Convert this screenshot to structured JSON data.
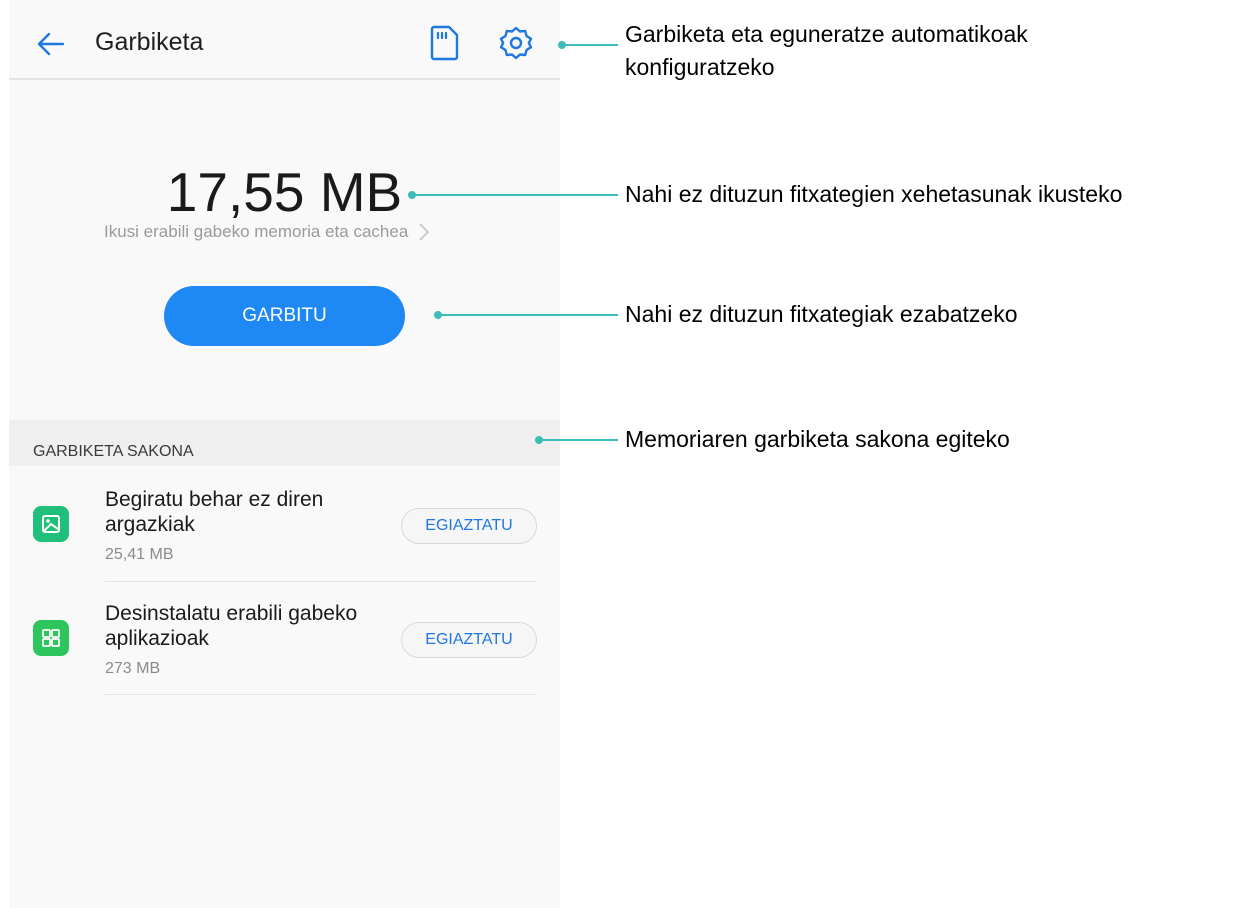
{
  "header": {
    "title": "Garbiketa",
    "back_icon": "arrow-left-icon",
    "sd_icon": "sd-card-icon",
    "settings_icon": "gear-icon"
  },
  "storage": {
    "size": "17,55 MB",
    "details_link": "Ikusi erabili gabeko memoria eta cachea"
  },
  "clean_button": {
    "label": "GARBITU",
    "color": "#1e88f5"
  },
  "deep_clean": {
    "header": "GARBIKETA SAKONA",
    "items": [
      {
        "title": "Begiratu behar ez diren argazkiak",
        "size": "25,41 MB",
        "button": "EGIAZTATU",
        "icon": "image-icon",
        "icon_color": "#21c07a"
      },
      {
        "title": "Desinstalatu erabili gabeko aplikazioak",
        "size": "273 MB",
        "button": "EGIAZTATU",
        "icon": "apps-grid-icon",
        "icon_color": "#2cc65d"
      }
    ]
  },
  "annotations": {
    "settings": "Garbiketa eta eguneratze automatikoak konfiguratzeko",
    "details": "Nahi ez dituzun fitxategien xehetasunak ikusteko",
    "clean": "Nahi ez dituzun fitxategiak ezabatzeko",
    "deep": "Memoriaren garbiketa sakona egiteko",
    "line_color": "#3dbdb8"
  }
}
